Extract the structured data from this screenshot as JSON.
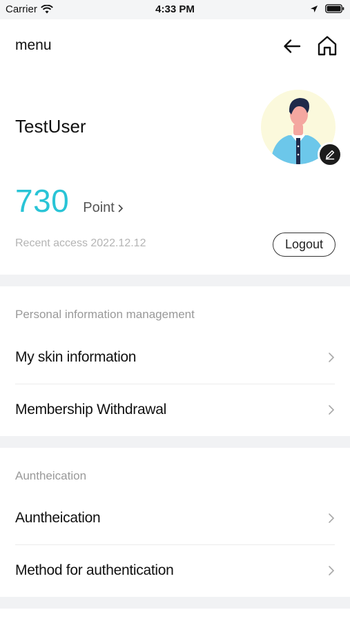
{
  "status_bar": {
    "carrier": "Carrier",
    "time": "4:33 PM"
  },
  "header": {
    "title": "menu",
    "back_icon": "arrow-left-icon",
    "home_icon": "home-icon"
  },
  "profile": {
    "username": "TestUser",
    "points_value": "730",
    "points_label": "Point",
    "recent_access": "Recent access 2022.12.12",
    "logout_label": "Logout"
  },
  "sections": [
    {
      "title": "Personal information management",
      "items": [
        {
          "label": "My skin information"
        },
        {
          "label": "Membership Withdrawal"
        }
      ]
    },
    {
      "title": "Auntheication",
      "items": [
        {
          "label": "Auntheication"
        },
        {
          "label": "Method for authentication"
        }
      ]
    }
  ],
  "colors": {
    "accent": "#29c4d6",
    "section_gap": "#f1f2f4",
    "muted_text": "#999999"
  }
}
